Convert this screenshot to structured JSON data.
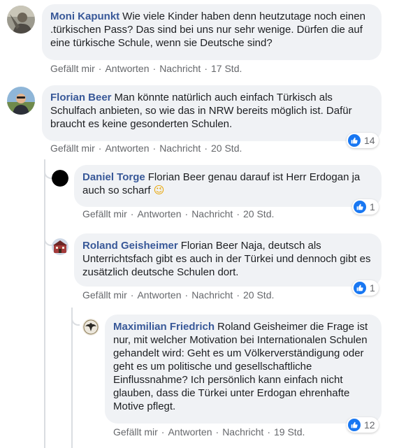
{
  "labels": {
    "like": "Gefällt mir",
    "reply": "Antworten",
    "message": "Nachricht",
    "dot": "·"
  },
  "comments": [
    {
      "author": "Moni Kapunkt",
      "text": "Wie viele Kinder haben denn heutzutage noch einen .türkischen Pass? Das sind bei uns nur sehr wenige. Dürfen die auf eine türkische Schule, wenn sie Deutsche sind?",
      "time": "17 Std.",
      "avatar_icon": "person-photo-avatar"
    },
    {
      "author": "Florian Beer",
      "text": "Man könnte natürlich auch einfach Türkisch als Schulfach anbieten, so wie das in NRW bereits möglich ist. Dafür braucht es keine gesonderten Schulen.",
      "time": "20 Std.",
      "likes": "14",
      "avatar_icon": "person-photo-avatar"
    },
    {
      "author": "Daniel Torge",
      "text": "Florian Beer genau darauf ist Herr Erdogan ja auch so scharf",
      "emoji": "😉",
      "time": "20 Std.",
      "likes": "1",
      "avatar_icon": "black-circle-avatar"
    },
    {
      "author": "Roland Geisheimer",
      "text": "Florian Beer Naja, deutsch als Unterrichtsfach gibt es auch in der Türkei und dennoch gibt es zusätzlich deutsche Schulen dort.",
      "time": "20 Std.",
      "likes": "1",
      "avatar_icon": "building-photo-avatar"
    },
    {
      "author": "Maximilian Friedrich",
      "text": "Roland Geisheimer die Frage ist nur, mit welcher Motivation bei Internationalen Schulen gehandelt wird: Geht es um Völkerverständigung oder geht es um politische und gesellschaftliche Einflussnahme? Ich persönlich kann einfach nicht glauben, dass die Türkei unter Erdogan ehrenhafte Motive pflegt.",
      "time": "19 Std.",
      "likes": "12",
      "avatar_icon": "eagle-emblem-avatar"
    }
  ],
  "colors": {
    "author": "#385898",
    "bubble": "#f0f2f5",
    "meta": "#65676b",
    "like_blue": "#1877f2"
  }
}
